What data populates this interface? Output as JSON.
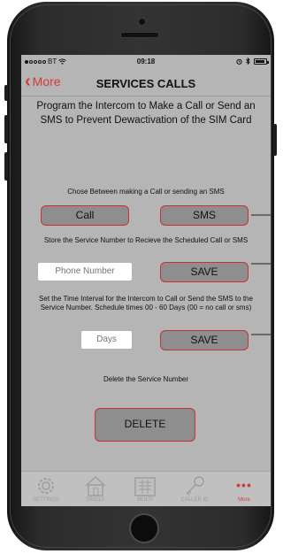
{
  "status_bar": {
    "carrier": "BT",
    "time": "09:18"
  },
  "nav": {
    "back_label": "More",
    "title": "SERVICES CALLS"
  },
  "intro": "Program the Intercom to Make a Call or Send an SMS to Prevent Dewactivation of the SIM Card",
  "call_section": {
    "caption": "Chose Between making a Call or sending an SMS",
    "call_label": "Call",
    "sms_label": "SMS"
  },
  "number_section": {
    "caption": "Store the Service Number to Recieve the Scheduled Call or SMS",
    "phone_placeholder": "Phone Number",
    "save_label": "SAVE"
  },
  "interval_section": {
    "caption": "Set the Time Interval for the Intercom to Call or Send the SMS to the Service Number. Schedule times 00 - 60 Days (00 = no call or sms)",
    "days_placeholder": "Days",
    "save_label": "SAVE"
  },
  "delete_section": {
    "caption": "Delete the Service Number",
    "delete_label": "DELETE"
  },
  "tabs": [
    {
      "label": "SETTINGS",
      "icon": "gear-icon"
    },
    {
      "label": "SINGLE",
      "icon": "house-icon"
    },
    {
      "label": "MULTI",
      "icon": "building-icon"
    },
    {
      "label": "CALLER ID",
      "icon": "key-icon"
    },
    {
      "label": "More",
      "icon": "more-dots-icon",
      "active": true
    }
  ],
  "colors": {
    "accent": "#d43a38",
    "screen_bg": "#b5b5b5",
    "button_bg": "#8e8e8e"
  }
}
